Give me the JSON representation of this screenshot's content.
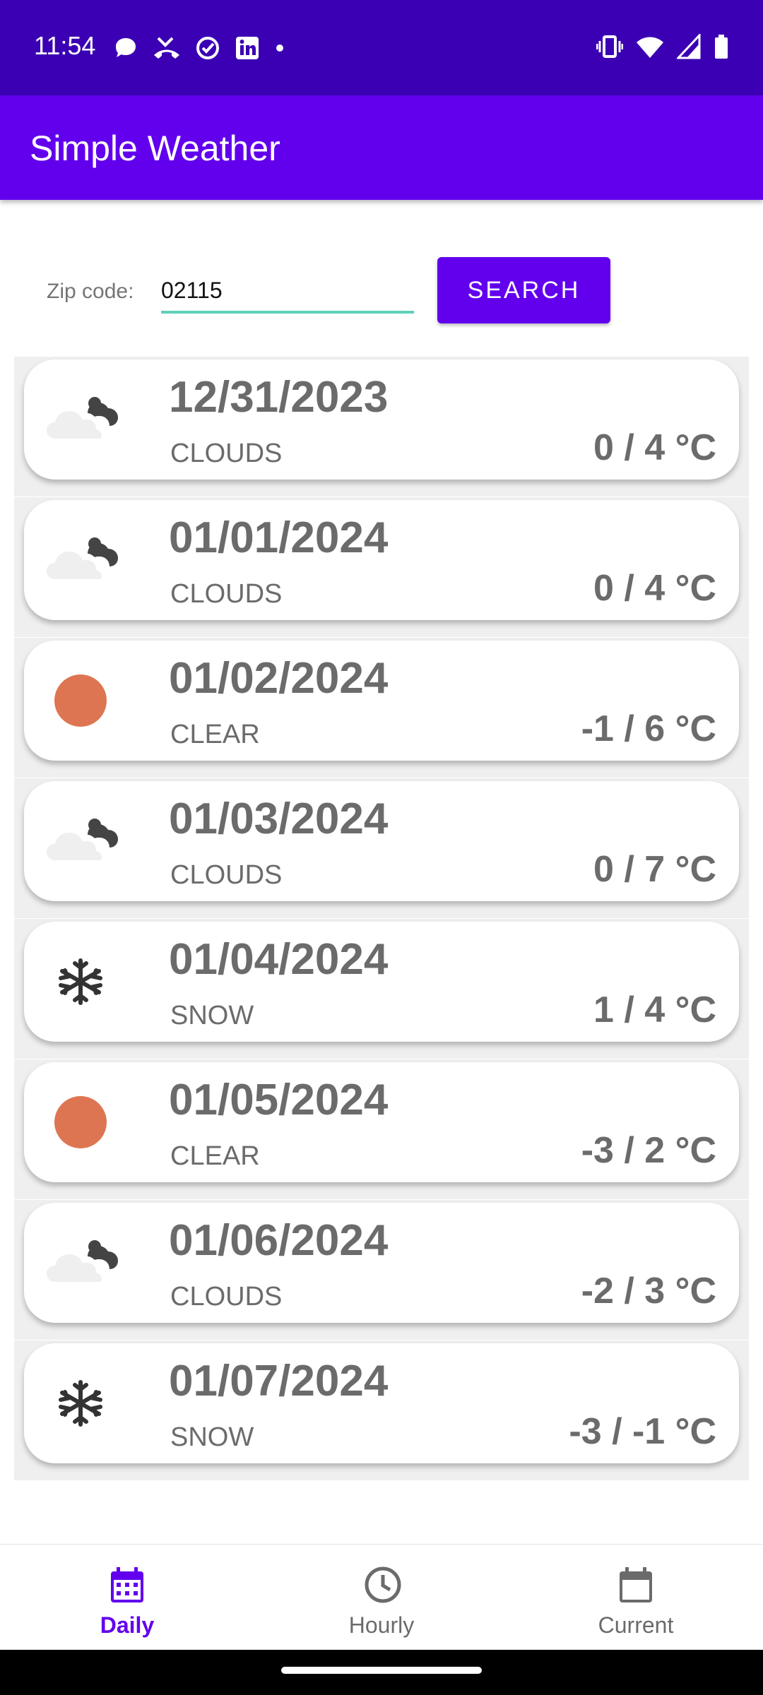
{
  "status_bar": {
    "time": "11:54",
    "left_icons": [
      "chat-bubble-icon",
      "missed-call-icon",
      "check-circle-icon",
      "linkedin-icon",
      "dot-icon"
    ],
    "right_icons": [
      "vibrate-icon",
      "wifi-icon",
      "signal-icon",
      "battery-icon"
    ]
  },
  "app_bar": {
    "title": "Simple Weather"
  },
  "search": {
    "label": "Zip code:",
    "value": "02115",
    "button_label": "SEARCH"
  },
  "forecast": [
    {
      "date": "12/31/2023",
      "condition": "CLOUDS",
      "temp": "0 / 4 °C",
      "icon": "clouds"
    },
    {
      "date": "01/01/2024",
      "condition": "CLOUDS",
      "temp": "0 / 4 °C",
      "icon": "clouds"
    },
    {
      "date": "01/02/2024",
      "condition": "CLEAR",
      "temp": "-1 / 6 °C",
      "icon": "clear"
    },
    {
      "date": "01/03/2024",
      "condition": "CLOUDS",
      "temp": "0 / 7 °C",
      "icon": "clouds"
    },
    {
      "date": "01/04/2024",
      "condition": "SNOW",
      "temp": "1 / 4 °C",
      "icon": "snow"
    },
    {
      "date": "01/05/2024",
      "condition": "CLEAR",
      "temp": "-3 / 2 °C",
      "icon": "clear"
    },
    {
      "date": "01/06/2024",
      "condition": "CLOUDS",
      "temp": "-2 / 3 °C",
      "icon": "clouds"
    },
    {
      "date": "01/07/2024",
      "condition": "SNOW",
      "temp": "-3 / -1 °C",
      "icon": "snow"
    }
  ],
  "bottom_nav": [
    {
      "label": "Daily",
      "icon": "calendar-grid-icon",
      "active": true
    },
    {
      "label": "Hourly",
      "icon": "clock-icon",
      "active": false
    },
    {
      "label": "Current",
      "icon": "calendar-icon",
      "active": false
    }
  ],
  "colors": {
    "status_bar": "#3b00b3",
    "app_bar": "#6200ee",
    "accent": "#6200ee",
    "input_underline": "#5ed0b8",
    "sun": "#de7552",
    "text_muted": "#6b6b6b"
  }
}
